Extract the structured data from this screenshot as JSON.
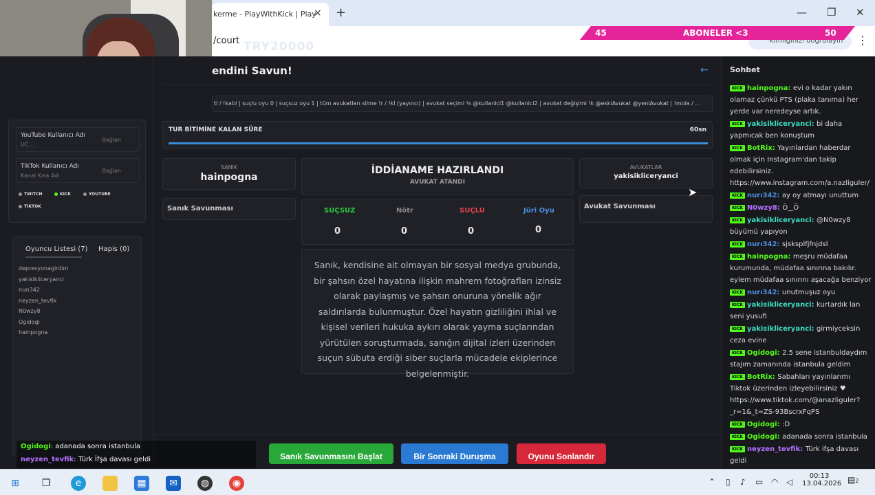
{
  "browser": {
    "tab_title": "kerme - PlayWithKick | Play",
    "close_tab": "×",
    "new_tab": "+",
    "url": "/court",
    "overlay_text": "TRY20000",
    "profile_label": "Kimliğinizi doğrulayın",
    "minimize": "—",
    "maximize": "❐",
    "close": "✕",
    "menu": "⋮"
  },
  "sub_banner": {
    "left": "45",
    "middle": "ABONELER <3",
    "right": "50"
  },
  "header": {
    "title": "endini Savun!",
    "back_icon": "←"
  },
  "commands": "tl / !katıl | suçlu oyu 0 | suçsuz oyu 1 | tüm avukatları silme !r / !kl (yayıncı) | avukat seçimi !s @kullanici1 @kullanici2 | avukat değişimi !k @eskiAvukat @yeniAvukat | !mola / ...",
  "timer": {
    "label": "TUR BİTİMİNE KALAN SÜRE",
    "value": "60sn",
    "progress_pct": 100
  },
  "left_panel": {
    "youtube": {
      "label": "YouTube Kullanıcı Adı",
      "placeholder": "UC...",
      "status": "Bağlan"
    },
    "tiktok": {
      "label": "TikTok Kullanıcı Adı",
      "placeholder": "Kanal Kısa Adı",
      "status": "Bağlan"
    },
    "platforms": [
      "TWITCH",
      "KICK",
      "YOUTUBE",
      "TIKTOK"
    ],
    "tabs": [
      "Oyuncu Listesi (7)",
      "Hapis (0)"
    ],
    "players": [
      "depresyonagirdim",
      "yakisikliceryanci",
      "nurı342",
      "neyzen_tevfik",
      "N0wzy8",
      "Ogidogi",
      "hainpogna"
    ]
  },
  "defendant": {
    "label": "SANIK",
    "name": "hainpogna",
    "defense_label": "Sanık Savunması"
  },
  "indictment": {
    "title": "İDDİANAME HAZIRLANDI",
    "subtitle": "AVUKAT ATANDI"
  },
  "votes": [
    {
      "label": "SUÇSUZ",
      "count": "0",
      "color": "#2ecc40"
    },
    {
      "label": "Nötr",
      "count": "0",
      "color": "#8a8a8a"
    },
    {
      "label": "SUÇLU",
      "count": "0",
      "color": "#e8414d"
    },
    {
      "label": "Jüri Oyu",
      "count": "0",
      "color": "#4a90e2"
    }
  ],
  "lawyers": {
    "label": "AVUKATLAR",
    "name": "yakisikliceryanci",
    "defense_label": "Avukat Savunması"
  },
  "case_text": "Sanık, kendisine ait olmayan bir sosyal medya grubunda, bir şahsın özel hayatına ilişkin mahrem fotoğrafları izinsiz olarak paylaşmış ve şahsın onuruna yönelik ağır saldırılarda bulunmuştur. Özel hayatın gizliliğini ihlal ve kişisel verileri hukuka aykırı olarak yayma suçlarından yürütülen soruşturmada, sanığın dijital izleri üzerinden suçun sübuta erdiği siber suçlarla mücadele ekiplerince belgelenmiştir.",
  "buttons": {
    "start_defense": "Sanık Savunmasını Başlat",
    "next_hearing": "Bir Sonraki Duruşma",
    "end_game": "Oyunu Sonlandır"
  },
  "chat": {
    "title": "Sohbet",
    "badge": "KICK",
    "messages": [
      {
        "user": "hainpogna",
        "color": "#53fc18",
        "text": "evi o kadar yakın olamaz çünkü PTS (plaka tanıma) her yerde var neredeyse artık."
      },
      {
        "user": "yakisikliceryanci",
        "color": "#3ee0c4",
        "text": "bi daha yapmıcak ben konuştum"
      },
      {
        "user": "BotRix",
        "color": "#53fc18",
        "text": "Yayınlardan haberdar olmak için Instagram'dan takip edebilirsiniz. https://www.instagram.com/a.nazliguler/"
      },
      {
        "user": "nurı342",
        "color": "#4a90e2",
        "text": "ay oy atmayı unuttum"
      },
      {
        "user": "N0wzy8",
        "color": "#b374ff",
        "text": "Ö‿Ö"
      },
      {
        "user": "yakisikliceryanci",
        "color": "#3ee0c4",
        "text": "@N0wzy8 büyümü yapıyon"
      },
      {
        "user": "nurı342",
        "color": "#4a90e2",
        "text": "sjsksplfjfnjdsl"
      },
      {
        "user": "hainpogna",
        "color": "#53fc18",
        "text": "meşru müdafaa kurumunda, müdafaa sınırına bakılır. eylem müdafaa sınırını aşacağa benziyor"
      },
      {
        "user": "nurı342",
        "color": "#4a90e2",
        "text": "unutmuşuz oyu"
      },
      {
        "user": "yakisikliceryanci",
        "color": "#3ee0c4",
        "text": "kurtardık lan seni yusufi"
      },
      {
        "user": "yakisikliceryanci",
        "color": "#3ee0c4",
        "text": "girmiyceksin ceza evine"
      },
      {
        "user": "Ogidogi",
        "color": "#53fc18",
        "text": "2.5 sene istanbuldaydım stajım zamanında istanbula geldim"
      },
      {
        "user": "BotRix",
        "color": "#53fc18",
        "text": "Sabahları yayınlarımı Tiktok üzerinden izleyebilirsiniz ♥ https://www.tiktok.com/@anazliguler?_r=1&_t=ZS-93BscrxFqPS"
      },
      {
        "user": "Ogidogi",
        "color": "#53fc18",
        "text": ":D"
      },
      {
        "user": "Ogidogi",
        "color": "#53fc18",
        "text": "adanada sonra istanbula"
      },
      {
        "user": "neyzen_tevfik",
        "color": "#b374ff",
        "text": "Türk ifşa davası geldi"
      }
    ]
  },
  "overlay_chat": [
    {
      "user": "Ogidogi",
      "text": ": adanada sonra istanbula"
    },
    {
      "user": "neyzen_tevfik",
      "text": ": Türk İfşa davası geldi"
    }
  ],
  "taskbar": {
    "time": "00:13",
    "date": "13.04.2026",
    "notif_count": "2"
  }
}
